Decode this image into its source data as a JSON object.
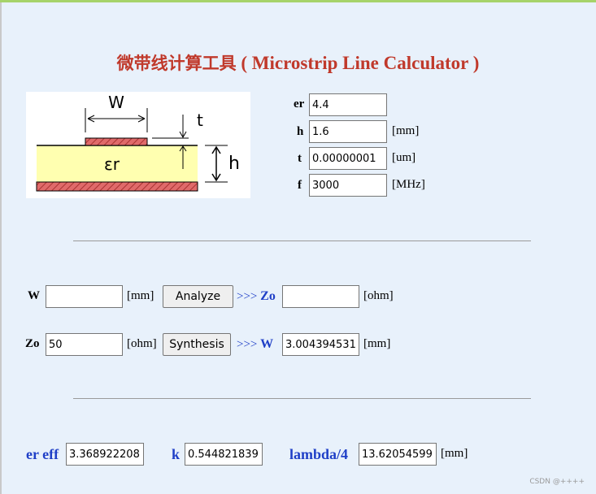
{
  "title": {
    "cjk": "微带线计算工具",
    "latin": " ( Microstrip Line Calculator )"
  },
  "diagram": {
    "w_label": "W",
    "t_label": "t",
    "er_label": "εr",
    "h_label": "h"
  },
  "params": {
    "er": {
      "label": "er",
      "value": "4.4",
      "unit": ""
    },
    "h": {
      "label": "h",
      "value": "1.6",
      "unit": "[mm]"
    },
    "t": {
      "label": "t",
      "value": "0.00000001",
      "unit": "[um]"
    },
    "f": {
      "label": "f",
      "value": "3000",
      "unit": "[MHz]"
    }
  },
  "analyze_row": {
    "label": "W",
    "value": "",
    "unit": "[mm]",
    "button": "Analyze",
    "arrow_prefix": ">>>",
    "result_label": "Zo",
    "result_value": "",
    "result_unit": "[ohm]"
  },
  "synthesis_row": {
    "label": "Zo",
    "value": "50",
    "unit": "[ohm]",
    "button": "Synthesis",
    "arrow_prefix": ">>>",
    "result_label": "W",
    "result_value": "3.004394531",
    "result_unit": "[mm]"
  },
  "results": {
    "er_eff_label": "er eff",
    "er_eff_value": "3.368922208",
    "k_label": "k",
    "k_value": "0.544821839",
    "lambda_label": "lambda/4",
    "lambda_value": "13.62054599",
    "lambda_unit": "[mm]"
  },
  "watermark": "CSDN @++++",
  "colors": {
    "title": "#c0392b",
    "accent_blue": "#1f3fc7",
    "background": "#e8f1fb",
    "substrate": "#ffffb0",
    "conductor": "#e06a6a"
  }
}
